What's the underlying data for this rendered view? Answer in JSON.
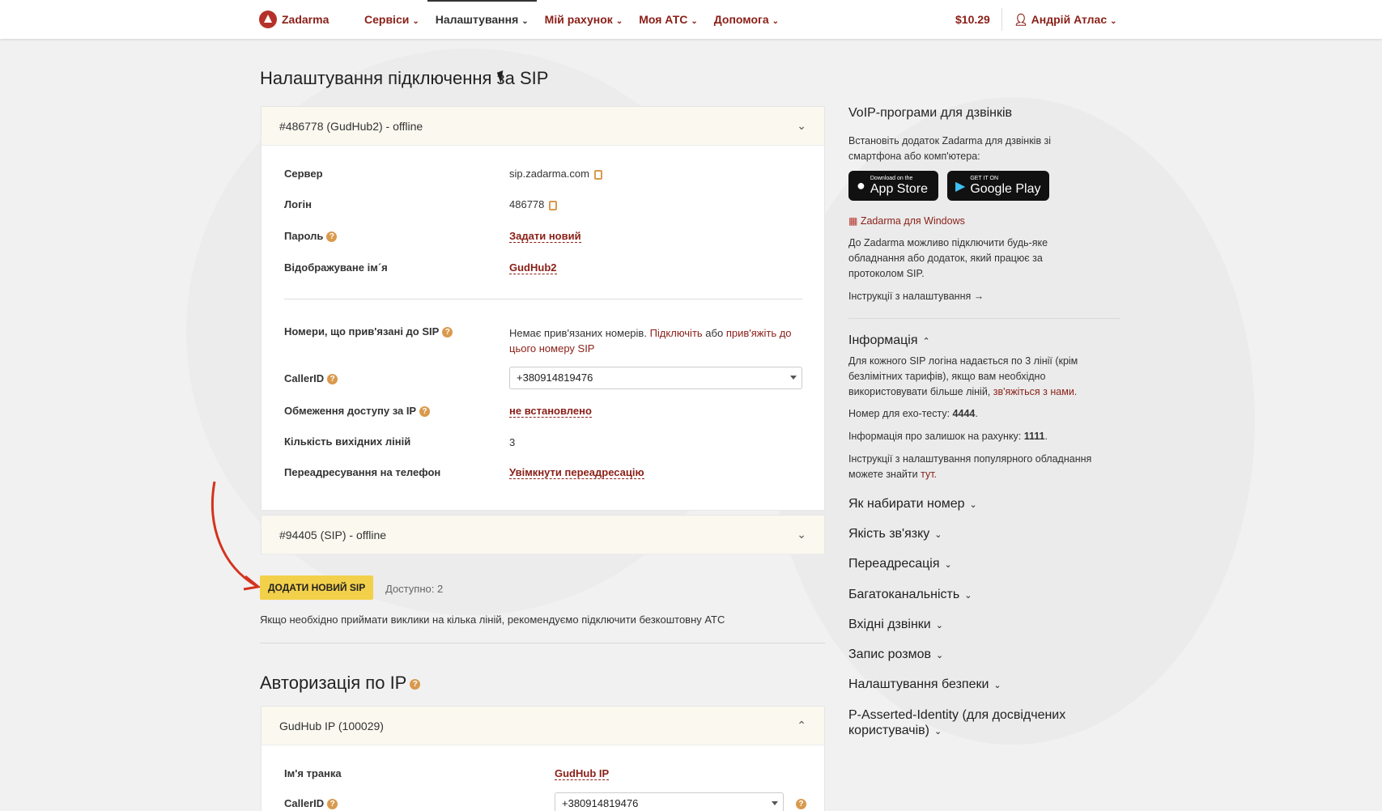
{
  "header": {
    "logo": "Zadarma",
    "nav": [
      {
        "label": "Сервіси"
      },
      {
        "label": "Налаштування"
      },
      {
        "label": "Мій рахунок"
      },
      {
        "label": "Моя АТС"
      },
      {
        "label": "Допомога"
      }
    ],
    "balance": "$10.29",
    "user": "Андрій Атлас"
  },
  "main": {
    "title": "Налаштування підключення за SIP",
    "sip1": {
      "header": "#486778 (GudHub2) - offline",
      "server_label": "Сервер",
      "server_value": "sip.zadarma.com",
      "login_label": "Логін",
      "login_value": "486778",
      "password_label": "Пароль",
      "password_value": "Задати новий",
      "display_label": "Відображуване ім´я",
      "display_value": "GudHub2",
      "numbers_label": "Номери, що прив'язані до SIP",
      "numbers_text": "Немає прив'язаних номерів.",
      "numbers_link1": "Підключіть",
      "numbers_or": "або",
      "numbers_link2": "прив'яжіть до цього номеру SIP",
      "callerid_label": "CallerID",
      "callerid_value": "+380914819476",
      "iprestrict_label": "Обмеження доступу за IP",
      "iprestrict_value": "не встановлено",
      "lines_label": "Кількість вихідних ліній",
      "lines_value": "3",
      "forward_label": "Переадресування на телефон",
      "forward_value": "Увімкнути переадресацію"
    },
    "sip2": {
      "header": "#94405 (SIP) - offline"
    },
    "add_button": "ДОДАТИ НОВИЙ SIP",
    "available": "Доступно: 2",
    "hint": "Якщо необхідно приймати виклики на кілька ліній, рекомендуємо підключити безкоштовну АТС",
    "ip_section": {
      "title": "Авторизація по IP",
      "card_header": "GudHub IP (100029)",
      "trunk_label": "Ім'я транка",
      "trunk_value": "GudHub IP",
      "callerid_label": "CallerID",
      "callerid_value": "+380914819476"
    }
  },
  "sidebar": {
    "voip_title": "VoIP-програми для дзвінків",
    "voip_text": "Встановіть додаток Zadarma для дзвінків зі смартфона або комп'ютера:",
    "appstore_small": "Download on the",
    "appstore_big": "App Store",
    "gplay_small": "GET IT ON",
    "gplay_big": "Google Play",
    "windows_link": "Zadarma для Windows",
    "sip_text": "До Zadarma можливо підключити будь-яке обладнання або додаток, який працює за протоколом SIP.",
    "instructions_link": "Інструкції з налаштування →",
    "info_title": "Інформація",
    "info_text1": "Для кожного SIP логіна надається по 3 лінії (крім безлімітних тарифів), якщо вам необхідно використовувати більше ліній,",
    "info_link1": "зв'яжіться з нами.",
    "echo_text": "Номер для ехо-тесту:",
    "echo_num": "4444",
    "balance_text": "Інформація про залишок на рахунку:",
    "balance_num": "1111",
    "instr_text": "Інструкції з налаштування популярного обладнання можете знайти",
    "instr_link": "тут.",
    "accordions": [
      "Як набирати номер",
      "Якість зв'язку",
      "Переадресація",
      "Багатоканальність",
      "Вхідні дзвінки",
      "Запис розмов",
      "Налаштування безпеки",
      "P-Asserted-Identity (для досвідчених користувачів)"
    ]
  },
  "colors": {
    "brand": "#8a1f17",
    "button": "#f3d04a",
    "card_header": "#faf8ef"
  }
}
